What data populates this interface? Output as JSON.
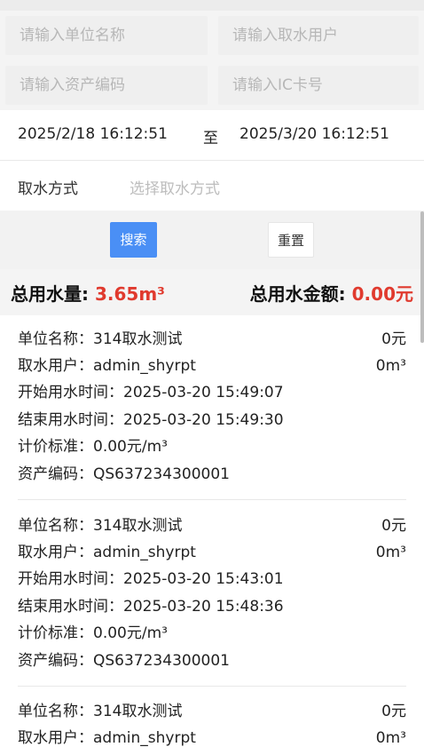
{
  "filters": {
    "unit_placeholder": "请输入单位名称",
    "user_placeholder": "请输入取水用户",
    "asset_placeholder": "请输入资产编码",
    "card_placeholder": "请输入IC卡号",
    "date_from": "2025/2/18 16:12:51",
    "date_sep": "至",
    "date_to": "2025/3/20 16:12:51",
    "mode_label": "取水方式",
    "mode_placeholder": "选择取水方式"
  },
  "buttons": {
    "search": "搜索",
    "reset": "重置"
  },
  "summary": {
    "total_water_label": "总用水量:",
    "total_water_value": "3.65m³",
    "total_amount_label": "总用水金额:",
    "total_amount_value": "0.00元"
  },
  "records": [
    {
      "unit": "单位名称：314取水测试",
      "user": "取水用户：admin_shyrpt",
      "start": "开始用水时间：2025-03-20 15:49:07",
      "end": "结束用水时间：2025-03-20 15:49:30",
      "price": "计价标准：0.00元/m³",
      "asset": "资产编码：QS637234300001",
      "amount": "0元",
      "volume": "0m³"
    },
    {
      "unit": "单位名称：314取水测试",
      "user": "取水用户：admin_shyrpt",
      "start": "开始用水时间：2025-03-20 15:43:01",
      "end": "结束用水时间：2025-03-20 15:48:36",
      "price": "计价标准：0.00元/m³",
      "asset": "资产编码：QS637234300001",
      "amount": "0元",
      "volume": "0m³"
    },
    {
      "unit": "单位名称：314取水测试",
      "user": "取水用户：admin_shyrpt",
      "amount": "0元",
      "volume": "0m³"
    }
  ]
}
